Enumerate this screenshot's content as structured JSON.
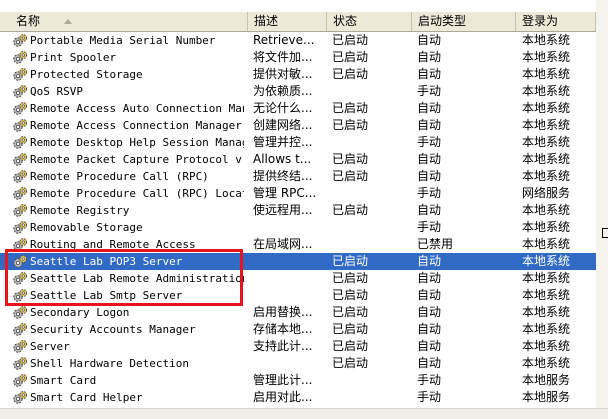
{
  "columns": {
    "name": "名称",
    "description": "描述",
    "status": "状态",
    "startup_type": "启动类型",
    "logon_as": "登录为"
  },
  "services": [
    {
      "name": "Portable Media Serial Number",
      "description": "Retrieve...",
      "status": "已启动",
      "startup": "自动",
      "logon": "本地系统"
    },
    {
      "name": "Print Spooler",
      "description": "将文件加...",
      "status": "已启动",
      "startup": "自动",
      "logon": "本地系统"
    },
    {
      "name": "Protected Storage",
      "description": "提供对敏...",
      "status": "已启动",
      "startup": "自动",
      "logon": "本地系统"
    },
    {
      "name": "QoS RSVP",
      "description": "为依赖质...",
      "status": "",
      "startup": "手动",
      "logon": "本地系统"
    },
    {
      "name": "Remote Access Auto Connection Man...",
      "description": "无论什么...",
      "status": "已启动",
      "startup": "自动",
      "logon": "本地系统"
    },
    {
      "name": "Remote Access Connection Manager",
      "description": "创建网络...",
      "status": "已启动",
      "startup": "自动",
      "logon": "本地系统"
    },
    {
      "name": "Remote Desktop Help Session Manager",
      "description": "管理并控...",
      "status": "",
      "startup": "手动",
      "logon": "本地系统"
    },
    {
      "name": "Remote Packet Capture Protocol v....",
      "description": "Allows t...",
      "status": "已启动",
      "startup": "自动",
      "logon": "本地系统"
    },
    {
      "name": "Remote Procedure Call (RPC)",
      "description": "提供终结...",
      "status": "已启动",
      "startup": "自动",
      "logon": "本地系统"
    },
    {
      "name": "Remote Procedure Call (RPC) Locator",
      "description": "管理 RPC...",
      "status": "",
      "startup": "手动",
      "logon": "网络服务"
    },
    {
      "name": "Remote Registry",
      "description": "使远程用...",
      "status": "已启动",
      "startup": "自动",
      "logon": "本地系统"
    },
    {
      "name": "Removable Storage",
      "description": "",
      "status": "",
      "startup": "手动",
      "logon": "本地系统"
    },
    {
      "name": "Routing and Remote Access",
      "description": "在局域网...",
      "status": "",
      "startup": "已禁用",
      "logon": "本地系统"
    },
    {
      "name": "Seattle Lab POP3 Server",
      "description": "",
      "status": "已启动",
      "startup": "自动",
      "logon": "本地系统",
      "selected": true
    },
    {
      "name": "Seattle Lab Remote Administration",
      "description": "",
      "status": "已启动",
      "startup": "自动",
      "logon": "本地系统"
    },
    {
      "name": "Seattle Lab Smtp Server",
      "description": "",
      "status": "已启动",
      "startup": "自动",
      "logon": "本地系统"
    },
    {
      "name": "Secondary Logon",
      "description": "启用替换...",
      "status": "已启动",
      "startup": "自动",
      "logon": "本地系统"
    },
    {
      "name": "Security Accounts Manager",
      "description": "存储本地...",
      "status": "已启动",
      "startup": "自动",
      "logon": "本地系统"
    },
    {
      "name": "Server",
      "description": "支持此计...",
      "status": "已启动",
      "startup": "自动",
      "logon": "本地系统"
    },
    {
      "name": "Shell Hardware Detection",
      "description": "",
      "status": "已启动",
      "startup": "自动",
      "logon": "本地系统"
    },
    {
      "name": "Smart Card",
      "description": "管理此计...",
      "status": "",
      "startup": "手动",
      "logon": "本地服务"
    },
    {
      "name": "Smart Card Helper",
      "description": "启用对此...",
      "status": "",
      "startup": "手动",
      "logon": "本地服务"
    }
  ],
  "colors": {
    "selection": "#316ac5",
    "highlight_box": "#e8141c",
    "header_bg": "#ece9d8"
  },
  "icons": {
    "service": "gears-icon",
    "sort": "sort-ascending-icon"
  }
}
